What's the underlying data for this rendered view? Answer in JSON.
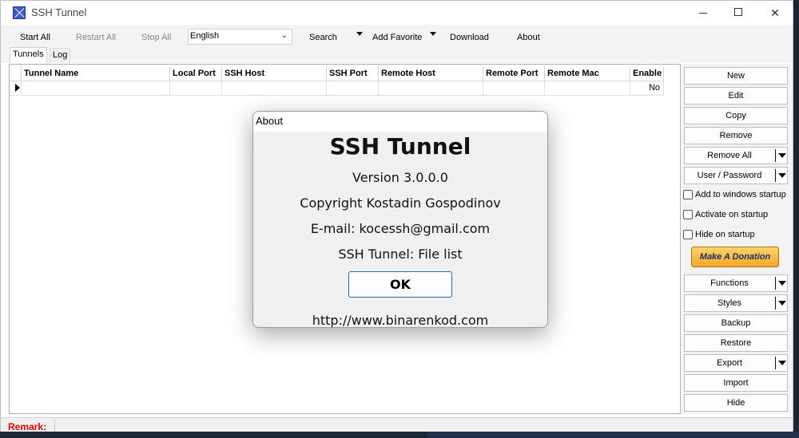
{
  "window": {
    "title": "SSH Tunnel"
  },
  "toolbar": {
    "start_all": "Start All",
    "restart_all": "Restart All",
    "stop_all": "Stop All",
    "language": "English",
    "search": "Search",
    "add_favorite": "Add Favorite",
    "download": "Download",
    "about": "About"
  },
  "tabs": [
    "Tunnels",
    "Log"
  ],
  "grid": {
    "columns": [
      "Tunnel Name",
      "Local Port",
      "SSH Host",
      "SSH Port",
      "Remote Host",
      "Remote Port",
      "Remote Mac",
      "Enable"
    ],
    "rows": [
      [
        "",
        "",
        "",
        "",
        "",
        "",
        "",
        "No"
      ]
    ]
  },
  "side": {
    "new": "New",
    "edit": "Edit",
    "copy": "Copy",
    "remove": "Remove",
    "remove_all": "Remove All",
    "user_password": "User / Password",
    "add_startup": "Add to windows startup",
    "activate_startup": "Activate on startup",
    "hide_startup": "Hide on startup",
    "donate": "Make A Donation",
    "functions": "Functions",
    "styles": "Styles",
    "backup": "Backup",
    "restore": "Restore",
    "export": "Export",
    "import": "Import",
    "hide": "Hide"
  },
  "status": {
    "remark": "Remark:"
  },
  "about_dialog": {
    "title": "About",
    "app_name": "SSH Tunnel",
    "version": "Version 3.0.0.0",
    "copyright": "Copyright Kostadin Gospodinov",
    "email": "E-mail: kocessh@gmail.com",
    "file_list": "SSH Tunnel: File list",
    "ok": "OK",
    "url": "http://www.binarenkod.com"
  },
  "colors": {
    "remark": "#e00000",
    "donate": "#f5a623",
    "ok_border": "#2a66b5"
  }
}
